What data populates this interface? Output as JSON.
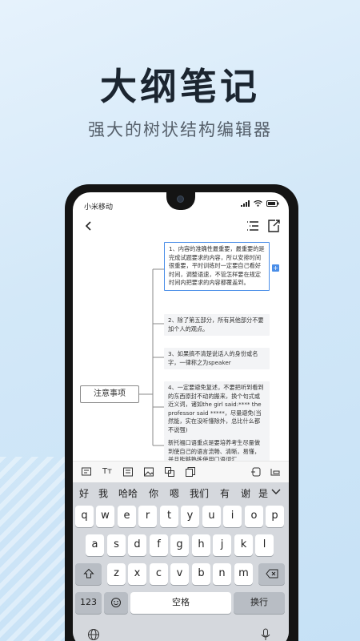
{
  "promo": {
    "title": "大纲笔记",
    "subtitle": "强大的树状结构编辑器"
  },
  "status_bar": {
    "carrier": "小米移动"
  },
  "mindmap": {
    "root_label": "注意事项",
    "children": [
      {
        "text": "1、内容的准确性最重要，最重要的是完成试题要求的内容，所以安排时间很重要，平时训练时一定要自己看好时间，调整语速，不管怎样要在规定时间内把要求的内容都覆盖到。",
        "selected": true
      },
      {
        "text": "2、除了第五部分，所有其他部分不要加个人的观点。",
        "selected": false
      },
      {
        "text": "3、如果搞不清楚说话人的身份或名字，一律称之为speaker",
        "selected": false
      },
      {
        "text": "4、一定要避免复述，不要把听到看到的东西原封不动的搬来，换个句式或近义词，诸如the girl said:**** the professor said *****，尽量避免(当然能，实在没听懂除外，总比什么都不说强)",
        "selected": false
      },
      {
        "text": "新托福口语重点是要培养考生尽量做到使自己的语言流畅、清晰，易懂，并且能够熟练使用口语词汇",
        "selected": false
      }
    ]
  },
  "toolbar": {
    "icons": [
      "note-icon",
      "text-format-icon",
      "comment-icon",
      "image-icon",
      "convert-icon",
      "copy-icon",
      "outdent-icon",
      "indent-icon"
    ],
    "text_format_label": "Tт"
  },
  "keyboard": {
    "candidates": [
      "好",
      "我",
      "哈哈",
      "你",
      "嗯",
      "我们",
      "有",
      "谢",
      "是"
    ],
    "row1": [
      "q",
      "w",
      "e",
      "r",
      "t",
      "y",
      "u",
      "i",
      "o",
      "p"
    ],
    "row2": [
      "a",
      "s",
      "d",
      "f",
      "g",
      "h",
      "j",
      "k",
      "l"
    ],
    "row3": [
      "z",
      "x",
      "c",
      "v",
      "b",
      "n",
      "m"
    ],
    "numbers_label": "123",
    "space_label": "空格",
    "return_label": "换行"
  },
  "colors": {
    "accent": "#4a8ee8",
    "phone_frame": "#141414",
    "node_bg": "#f3f4f6"
  }
}
